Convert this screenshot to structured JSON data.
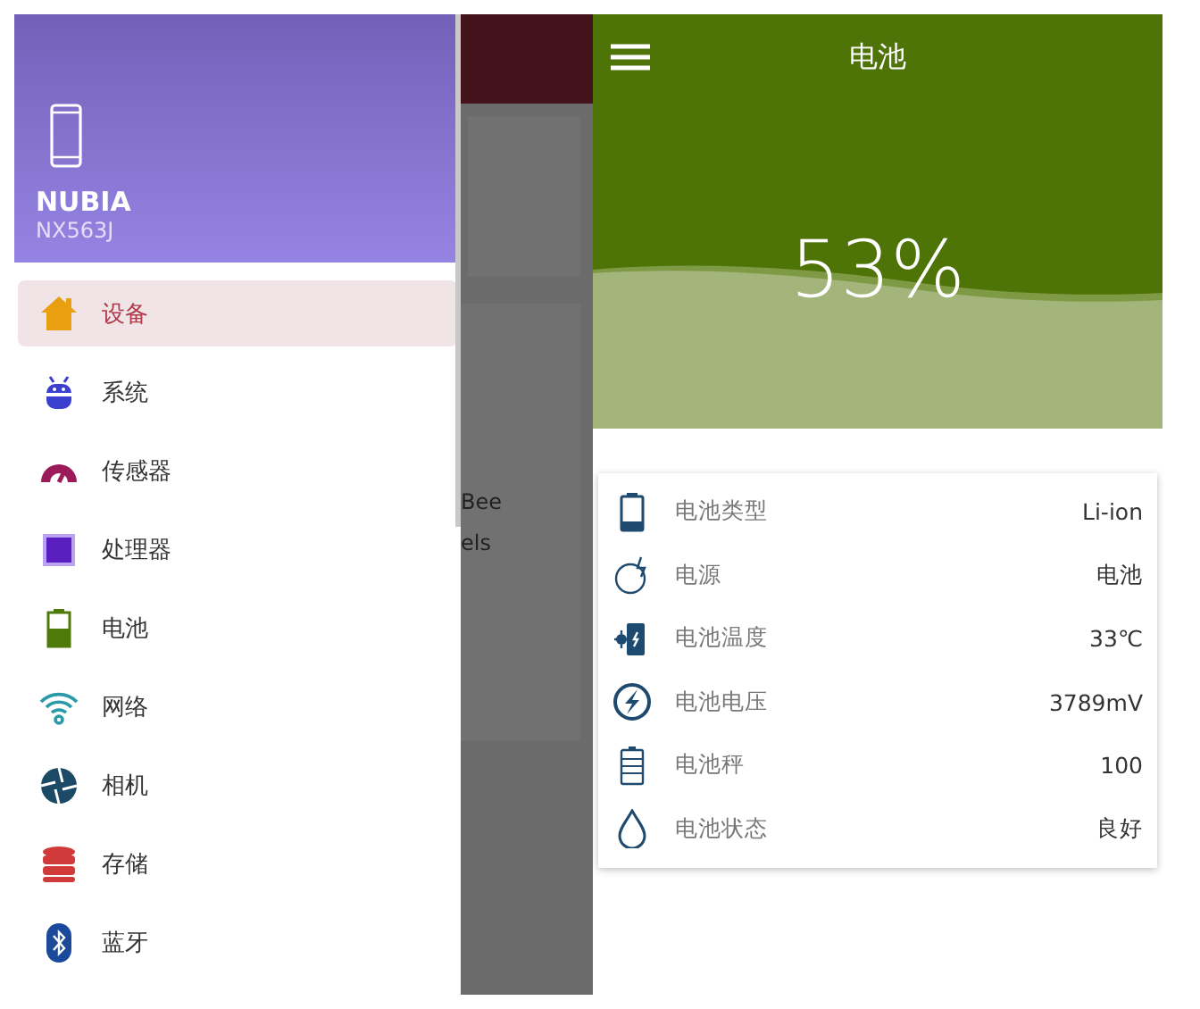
{
  "drawer": {
    "device_name": "NUBIA",
    "device_model": "NX563J",
    "items": [
      {
        "label": "设备",
        "selected": true
      },
      {
        "label": "系统",
        "selected": false
      },
      {
        "label": "传感器",
        "selected": false
      },
      {
        "label": "处理器",
        "selected": false
      },
      {
        "label": "电池",
        "selected": false
      },
      {
        "label": "网络",
        "selected": false
      },
      {
        "label": "相机",
        "selected": false
      },
      {
        "label": "存储",
        "selected": false
      },
      {
        "label": "蓝牙",
        "selected": false
      }
    ]
  },
  "background_content": {
    "texts": [
      "Bee",
      "els"
    ]
  },
  "battery_screen": {
    "title": "电池",
    "percentage": "53%",
    "rows": [
      {
        "label": "电池类型",
        "value": "Li-ion"
      },
      {
        "label": "电源",
        "value": "电池"
      },
      {
        "label": "电池温度",
        "value": "33℃"
      },
      {
        "label": "电池电压",
        "value": "3789mV"
      },
      {
        "label": "电池秤",
        "value": "100"
      },
      {
        "label": "电池状态",
        "value": "良好"
      }
    ]
  }
}
